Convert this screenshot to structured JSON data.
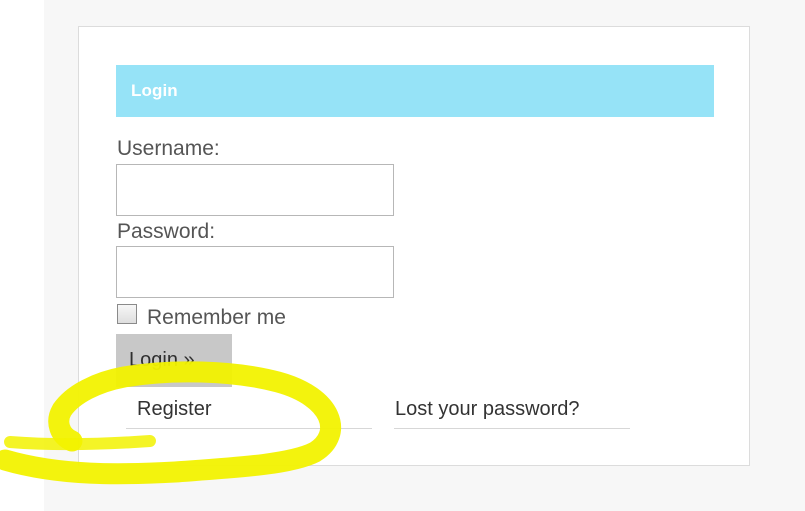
{
  "login_box": {
    "title": "Login",
    "username_label": "Username:",
    "username_value": "",
    "password_label": "Password:",
    "password_value": "",
    "remember_label": "Remember me",
    "remember_checked": false,
    "login_button_label": "Login »",
    "register_link_label": "Register",
    "lost_password_link_label": "Lost your password?"
  },
  "colors": {
    "header_bg": "#96e3f7",
    "highlight": "#f2f200"
  }
}
